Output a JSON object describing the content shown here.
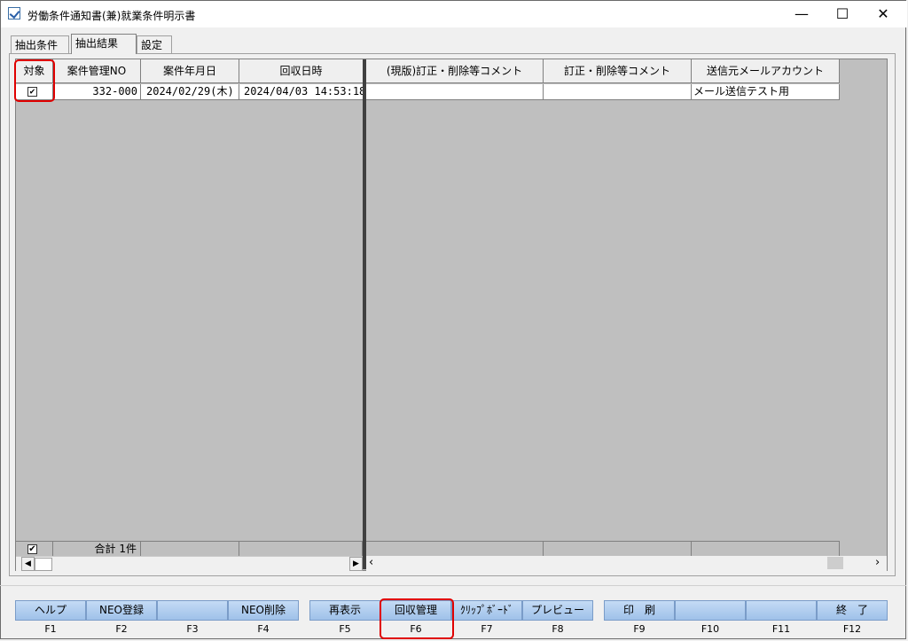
{
  "window": {
    "title": "労働条件通知書(兼)就業条件明示書",
    "min": "—",
    "max": "☐",
    "close": "✕"
  },
  "tabs": [
    "抽出条件",
    "抽出結果",
    "設定"
  ],
  "grid": {
    "headers": [
      "対象",
      "案件管理NO",
      "案件年月日",
      "回収日時",
      "(現版)訂正・削除等コメント",
      "訂正・削除等コメント",
      "送信元メールアカウント"
    ],
    "row": {
      "checked": "✔",
      "case_no": "332-000",
      "date": "2024/02/29(木)",
      "collected": "2024/04/03 14:53:18",
      "current_comment": "",
      "comment": "",
      "sender": "メール送信テスト用"
    },
    "footer": {
      "checked": "✔",
      "total": "合計  1件"
    }
  },
  "fkeys": [
    {
      "label": "ヘルプ",
      "key": "F1"
    },
    {
      "label": "NEO登録",
      "key": "F2"
    },
    {
      "label": "",
      "key": "F3"
    },
    {
      "label": "NEO削除",
      "key": "F4"
    },
    {
      "label": "再表示",
      "key": "F5"
    },
    {
      "label": "回収管理",
      "key": "F6"
    },
    {
      "label": "ｸﾘｯﾌﾟﾎﾞｰﾄﾞ",
      "key": "F7"
    },
    {
      "label": "プレビュー",
      "key": "F8"
    },
    {
      "label": "印　刷",
      "key": "F9"
    },
    {
      "label": "",
      "key": "F10"
    },
    {
      "label": "",
      "key": "F11"
    },
    {
      "label": "終　了",
      "key": "F12"
    }
  ],
  "colors": {
    "highlight": "#e00000",
    "grid_bg": "#bfbfbf",
    "fkey": "#b3cff0"
  }
}
